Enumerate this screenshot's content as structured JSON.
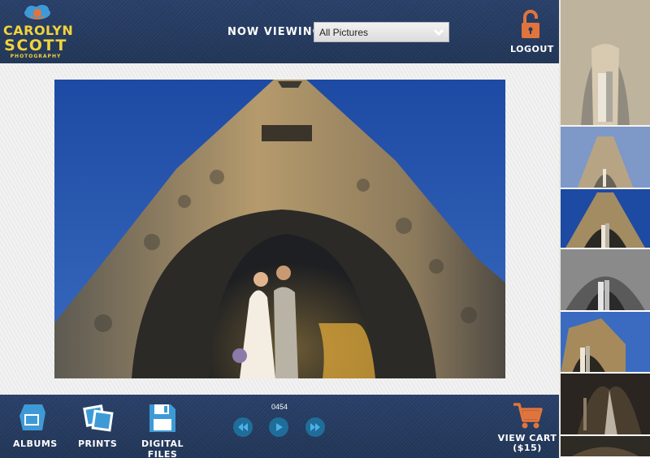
{
  "brand": {
    "line1": "CAROLYN",
    "line2": "SCOTT",
    "tagline": "PHOTOGRAPHY",
    "color": "#f2d33a"
  },
  "header": {
    "now_viewing_label": "NOW VIEWING:",
    "album_select_value": "All Pictures",
    "logout_label": "LOGOUT",
    "accent": "#e1743c"
  },
  "viewer": {
    "frame_number": "0454"
  },
  "footer": {
    "nav": [
      {
        "label": "ALBUMS",
        "icon": "album-icon"
      },
      {
        "label": "PRINTS",
        "icon": "prints-icon"
      },
      {
        "label": "DIGITAL FILES",
        "icon": "floppy-disk-icon"
      }
    ],
    "controls": [
      "rewind-icon",
      "play-icon",
      "fast-forward-icon"
    ],
    "cart_label": "VIEW CART",
    "cart_total": "($15)"
  },
  "thumbnails": [
    "thumb-1",
    "thumb-2",
    "thumb-3",
    "thumb-4",
    "thumb-5",
    "thumb-6",
    "thumb-7"
  ]
}
